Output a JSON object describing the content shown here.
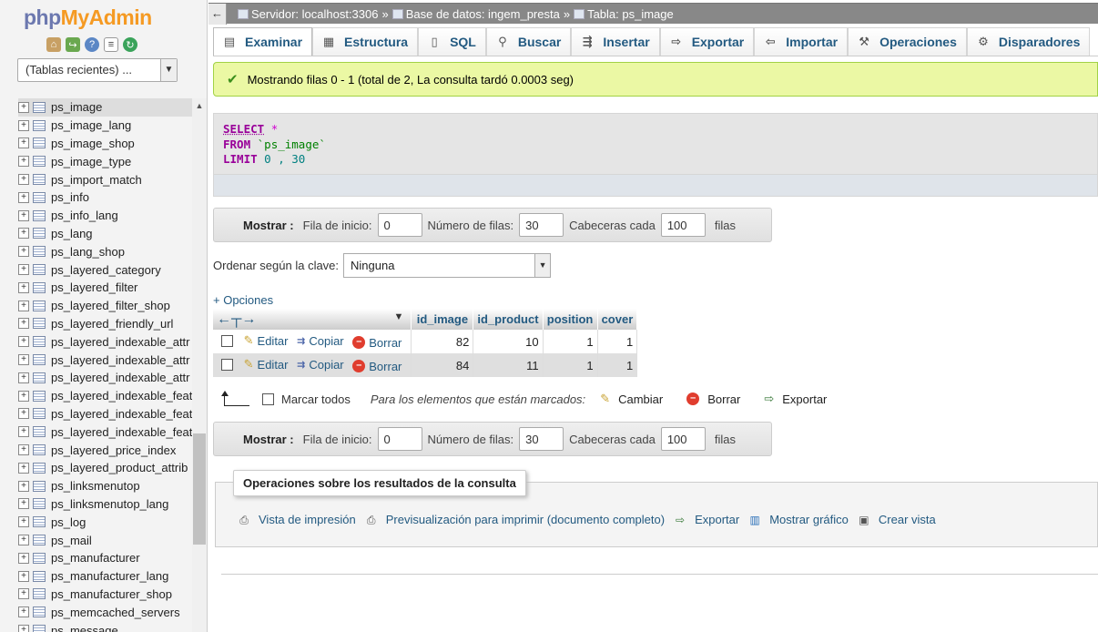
{
  "brand": {
    "php": "php",
    "my": "My",
    "admin": "Admin"
  },
  "nav": {
    "recent": "(Tablas recientes) ...",
    "tables": [
      "ps_image",
      "ps_image_lang",
      "ps_image_shop",
      "ps_image_type",
      "ps_import_match",
      "ps_info",
      "ps_info_lang",
      "ps_lang",
      "ps_lang_shop",
      "ps_layered_category",
      "ps_layered_filter",
      "ps_layered_filter_shop",
      "ps_layered_friendly_url",
      "ps_layered_indexable_attr",
      "ps_layered_indexable_attr",
      "ps_layered_indexable_attr",
      "ps_layered_indexable_feat",
      "ps_layered_indexable_feat",
      "ps_layered_indexable_feat",
      "ps_layered_price_index",
      "ps_layered_product_attrib",
      "ps_linksmenutop",
      "ps_linksmenutop_lang",
      "ps_log",
      "ps_mail",
      "ps_manufacturer",
      "ps_manufacturer_lang",
      "ps_manufacturer_shop",
      "ps_memcached_servers",
      "ps_message"
    ]
  },
  "breadcrumb": {
    "server": "Servidor: localhost:3306",
    "database": "Base de datos: ingem_presta",
    "table": "Tabla: ps_image"
  },
  "tabs": [
    "Examinar",
    "Estructura",
    "SQL",
    "Buscar",
    "Insertar",
    "Exportar",
    "Importar",
    "Operaciones",
    "Disparadores"
  ],
  "success": "Mostrando filas 0 - 1 (total de 2, La consulta tardó 0.0003 seg)",
  "sql": {
    "select": "SELECT",
    "star": "*",
    "from": "FROM",
    "table": "`ps_image`",
    "limit": "LIMIT",
    "limit_args": "0 , 30"
  },
  "pager": {
    "show": "Mostrar :",
    "start_label": "Fila de inicio:",
    "start": "0",
    "rows_label": "Número de filas:",
    "rows": "30",
    "headers_label": "Cabeceras cada",
    "headers": "100",
    "rows_suffix": "filas"
  },
  "sort": {
    "label": "Ordenar según la clave:",
    "value": "Ninguna"
  },
  "options_link": "+ Opciones",
  "table": {
    "columns": [
      "id_image",
      "id_product",
      "position",
      "cover"
    ],
    "actions": {
      "edit": "Editar",
      "copy": "Copiar",
      "delete": "Borrar"
    },
    "rows": [
      [
        "82",
        "10",
        "1",
        "1"
      ],
      [
        "84",
        "11",
        "1",
        "1"
      ]
    ]
  },
  "bulk": {
    "check_all": "Marcar todos",
    "with_selected": "Para los elementos que están marcados:",
    "change": "Cambiar",
    "delete": "Borrar",
    "export": "Exportar"
  },
  "ops": {
    "legend": "Operaciones sobre los resultados de la consulta",
    "print_view": "Vista de impresión",
    "print_full": "Previsualización para imprimir (documento completo)",
    "export": "Exportar",
    "chart": "Mostrar gráfico",
    "create_view": "Crear vista"
  },
  "colors": {
    "link": "#235a81",
    "success_bg": "#ebf8a4",
    "topbar": "#888888"
  }
}
